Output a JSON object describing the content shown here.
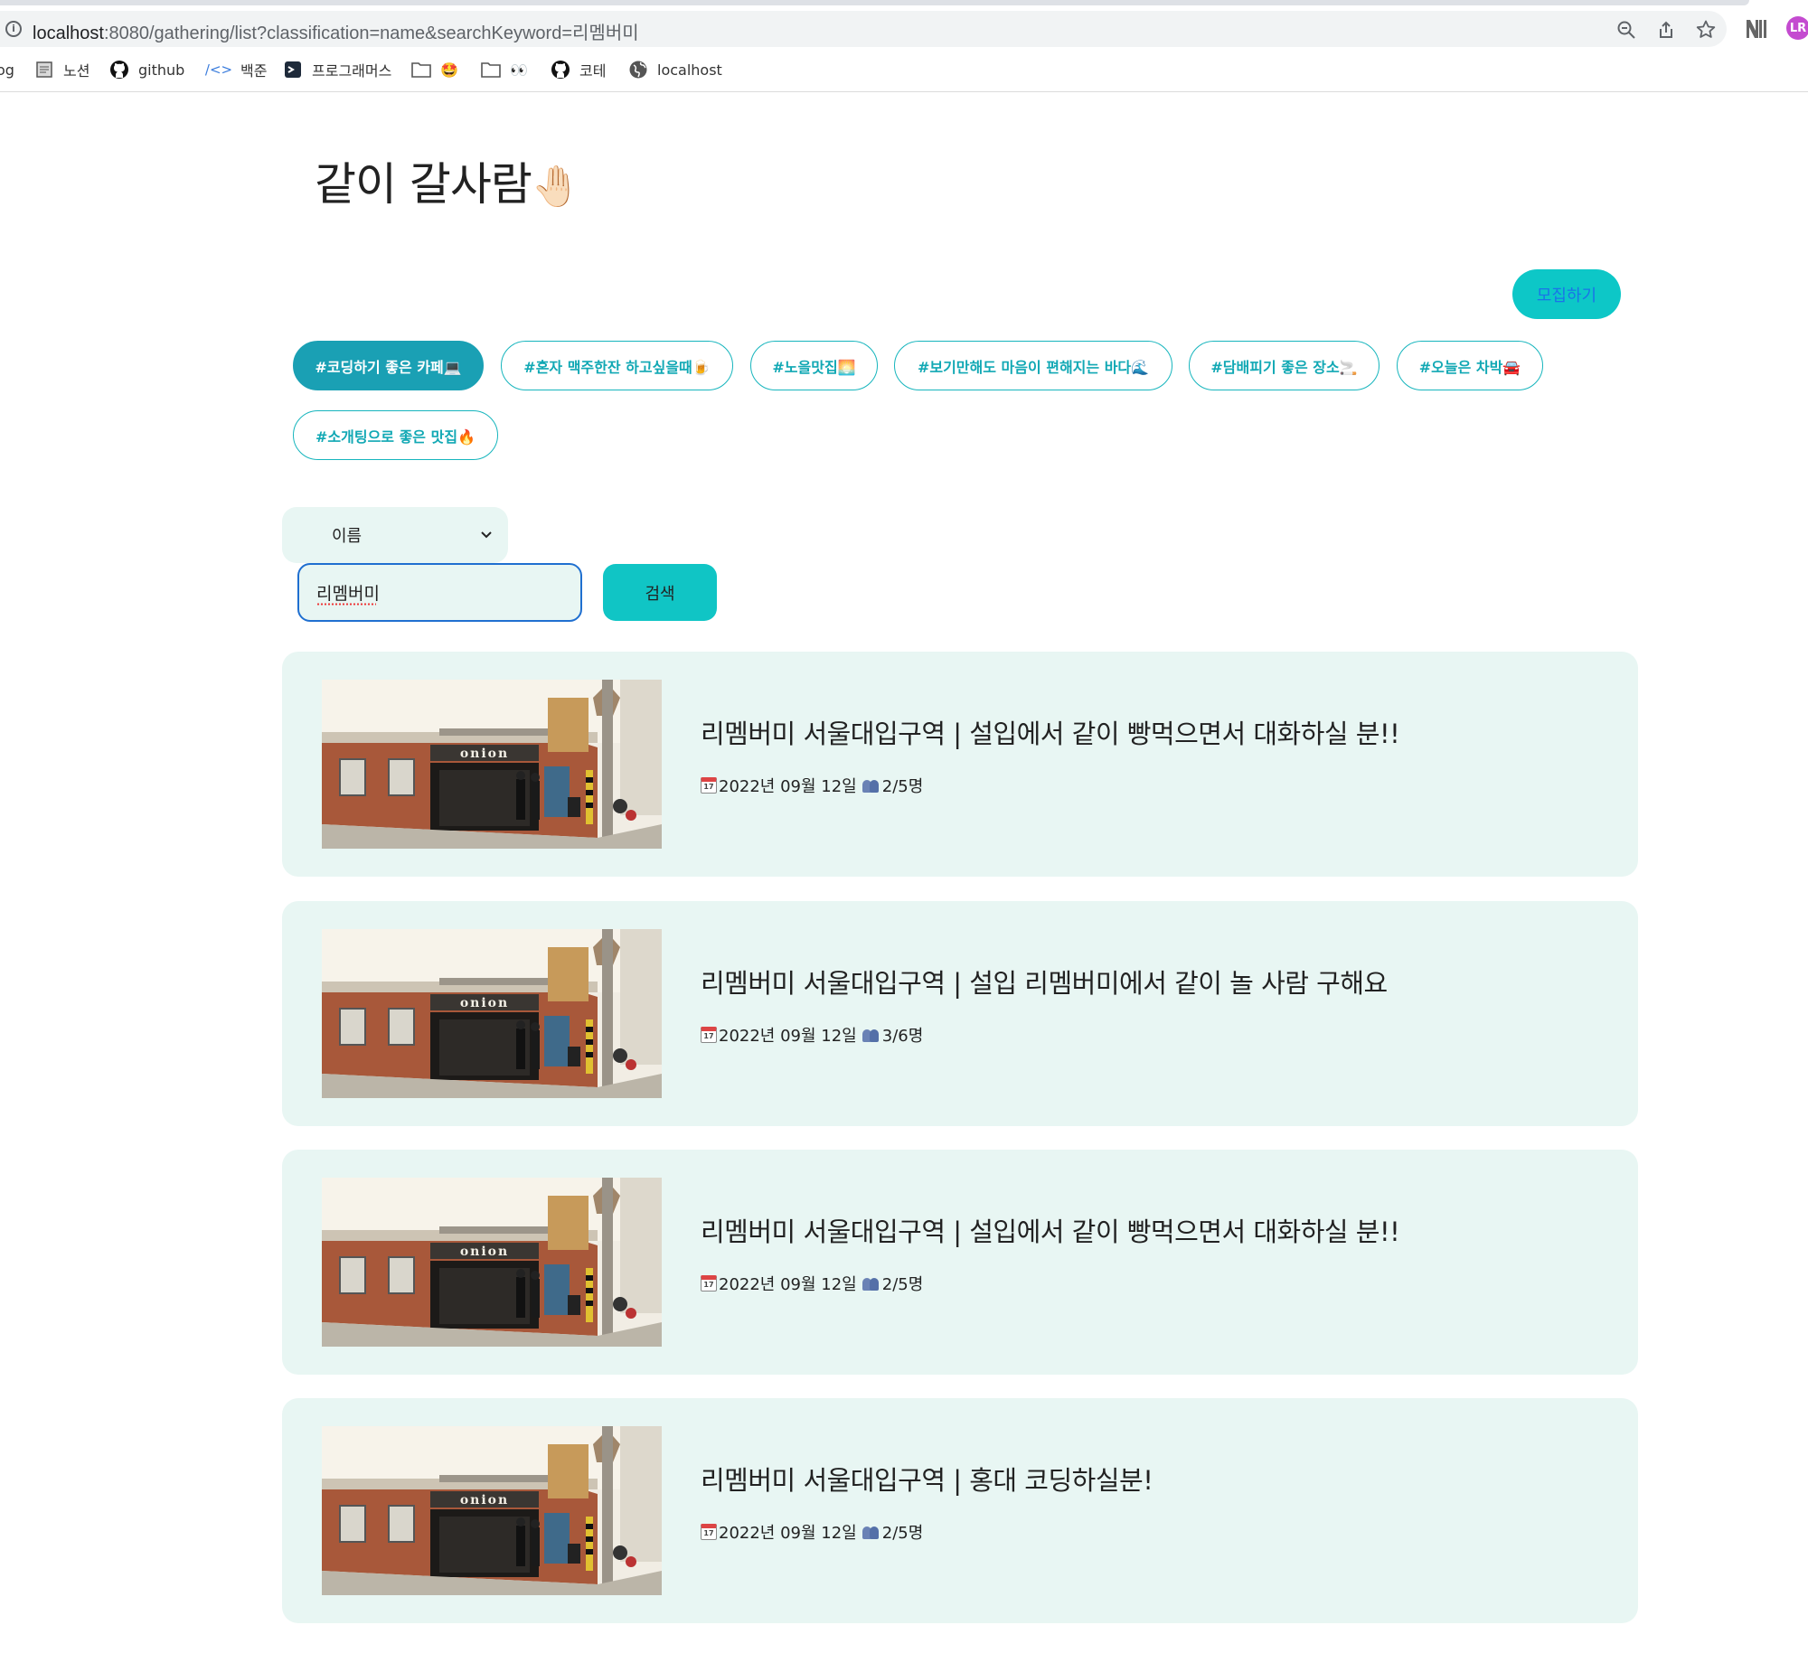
{
  "browser": {
    "url_host": "localhost",
    "url_rest": ":8080/gathering/list?classification=name&searchKeyword=리멤버미",
    "bookmarks": [
      {
        "label": "og",
        "icon": ""
      },
      {
        "label": "노션",
        "icon": "notion-icon"
      },
      {
        "label": "github",
        "icon": "github-icon"
      },
      {
        "label": "백준",
        "icon": "code-icon"
      },
      {
        "label": "프로그래머스",
        "icon": "programmers-icon"
      },
      {
        "label": "🤩",
        "icon": "folder-icon"
      },
      {
        "label": "👀",
        "icon": "folder-icon"
      },
      {
        "label": "코테",
        "icon": "github-icon"
      },
      {
        "label": "localhost",
        "icon": "globe-icon"
      }
    ],
    "extension_avatar": "LR"
  },
  "header": {
    "title": "같이 갈사람",
    "title_emoji": "🤚🏻",
    "recruit_button": "모집하기"
  },
  "tags": [
    {
      "label": "#코딩하기 좋은 카페💻",
      "active": true
    },
    {
      "label": "#혼자 맥주한잔 하고싶을때🍺",
      "active": false
    },
    {
      "label": "#노을맛집🌅",
      "active": false
    },
    {
      "label": "#보기만해도 마음이 편해지는 바다🌊",
      "active": false
    },
    {
      "label": "#담배피기 좋은 장소🚬",
      "active": false
    },
    {
      "label": "#오늘은 차박🚘",
      "active": false
    },
    {
      "label": "#소개팅으로 좋은 맛집🔥",
      "active": false
    }
  ],
  "search": {
    "classification_selected": "이름",
    "keyword_value": "리멤버미",
    "button_label": "검색"
  },
  "colors": {
    "accent": "#10c5c5",
    "active_tag": "#1aa0b4",
    "card_background": "#e8f6f3",
    "input_border": "#1f6fd0"
  },
  "gatherings": [
    {
      "title": "리멤버미 서울대입구역 | 설입에서 같이 빵먹으면서 대화하실 분!!",
      "date": "2022년 09월 12일",
      "people": "2/5명",
      "thumbnail_sign": "onion"
    },
    {
      "title": "리멤버미 서울대입구역 | 설입 리멤버미에서 같이 놀 사람 구해요",
      "date": "2022년 09월 12일",
      "people": "3/6명",
      "thumbnail_sign": "onion"
    },
    {
      "title": "리멤버미 서울대입구역 | 설입에서 같이 빵먹으면서 대화하실 분!!",
      "date": "2022년 09월 12일",
      "people": "2/5명",
      "thumbnail_sign": "onion"
    },
    {
      "title": "리멤버미 서울대입구역 | 홍대 코딩하실분!",
      "date": "2022년 09월 12일",
      "people": "2/5명",
      "thumbnail_sign": "onion"
    }
  ]
}
